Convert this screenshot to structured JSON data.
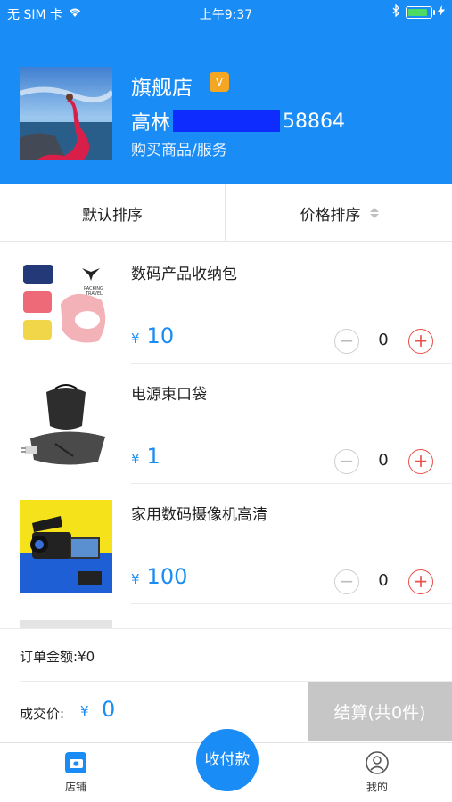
{
  "status_bar": {
    "carrier": "无 SIM 卡",
    "time": "上午9:37"
  },
  "store": {
    "name": "旗舰店",
    "badge": "V",
    "owner_prefix": "高林",
    "owner_suffix": "58864",
    "description": "购买商品/服务"
  },
  "sort": {
    "default_label": "默认排序",
    "price_label": "价格排序"
  },
  "products": [
    {
      "name": "数码产品收纳包",
      "currency": "¥",
      "price": "10",
      "qty": "0",
      "minus": "−",
      "plus": "+"
    },
    {
      "name": "电源束口袋",
      "currency": "¥",
      "price": "1",
      "qty": "0",
      "minus": "−",
      "plus": "+"
    },
    {
      "name": "家用数码摄像机高清",
      "currency": "¥",
      "price": "100",
      "qty": "0",
      "minus": "−",
      "plus": "+"
    }
  ],
  "summary": {
    "amount_label": "订单金额:¥0",
    "deal_label": "成交价:",
    "deal_currency": "¥",
    "deal_value": "0",
    "checkout_label": "结算(共0件)"
  },
  "tabbar": {
    "shop_label": "店铺",
    "collect_label": "收付款",
    "mine_label": "我的"
  },
  "colors": {
    "primary": "#1a8cf5",
    "plus_red": "#e8504a",
    "checkout_gray": "#c6c6c6"
  }
}
